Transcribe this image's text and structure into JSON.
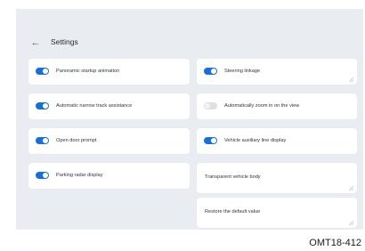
{
  "header": {
    "back_icon": "arrow-left-icon",
    "title": "Settings"
  },
  "left_column": [
    {
      "label": "Panoramic startup animation",
      "enabled": true
    },
    {
      "label": "Automatic narrow track assistance",
      "enabled": true
    },
    {
      "label": "Open door prompt",
      "enabled": true
    },
    {
      "label": "Parking radar display",
      "enabled": true
    }
  ],
  "right_column": [
    {
      "label": "Steering linkage",
      "enabled": true
    },
    {
      "label": "Automatically zoom in on the view",
      "enabled": false
    },
    {
      "label": "Vehicle auxiliary line display",
      "enabled": true
    },
    {
      "label": "Transparent vehicle body"
    },
    {
      "label": "Restore the default value"
    }
  ],
  "caption": "OMT18-412",
  "colors": {
    "accent": "#1a6fd6",
    "background": "#e9ecf1",
    "card": "#ffffff"
  }
}
